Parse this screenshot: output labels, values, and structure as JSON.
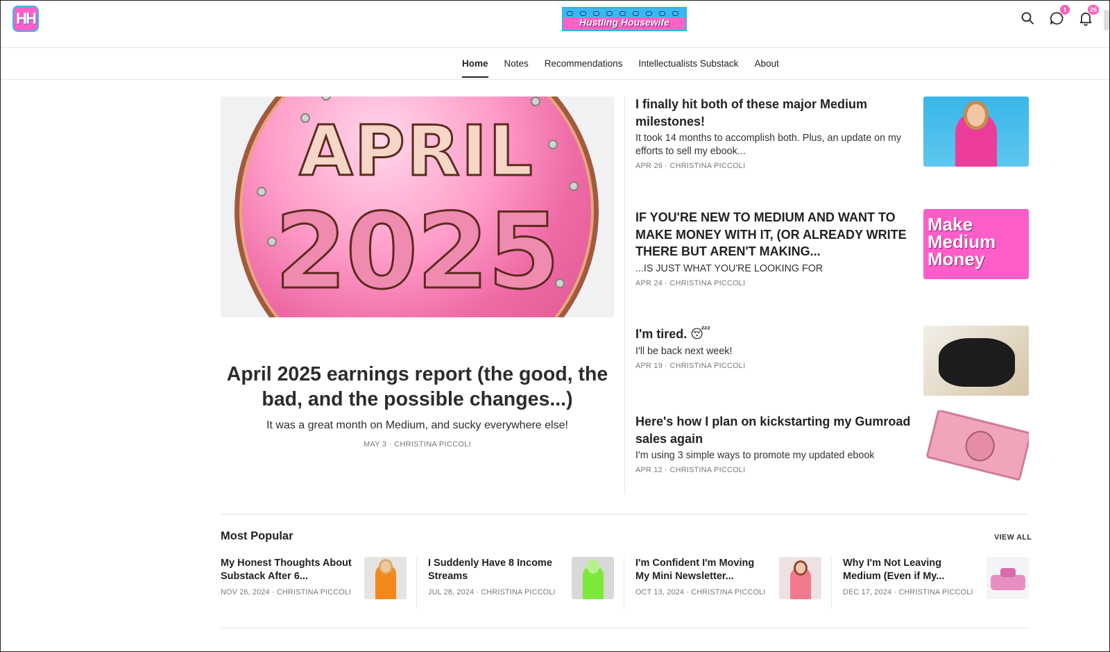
{
  "header": {
    "logo_text": "HH",
    "banner_text": "Hustling Housewife",
    "chat_badge": "1",
    "notification_badge": "26"
  },
  "nav": {
    "items": [
      "Home",
      "Notes",
      "Recommendations",
      "Intellectualists Substack",
      "About"
    ],
    "active": "Home"
  },
  "hero": {
    "image_text_line1": "APRIL",
    "image_text_line2": "2025",
    "title": "April 2025 earnings report (the good, the bad, and the possible changes...)",
    "subtitle": "It was a great month on Medium, and sucky everywhere else!",
    "meta": "MAY 3 · CHRISTINA PICCOLI"
  },
  "posts": [
    {
      "title": "I finally hit both of these major Medium milestones!",
      "subtitle": "It took 14 months to accomplish both. Plus, an update on my efforts to sell my ebook...",
      "meta": "APR 26 · CHRISTINA PICCOLI"
    },
    {
      "title": "IF YOU'RE NEW TO MEDIUM AND WANT TO MAKE MONEY WITH IT, (OR ALREADY WRITE THERE BUT AREN'T MAKING...",
      "subtitle": "...IS JUST WHAT YOU'RE LOOKING FOR",
      "meta": "APR 24 · CHRISTINA PICCOLI",
      "thumb_text": "Make Medium Money"
    },
    {
      "title": "I'm tired. 😴",
      "subtitle": "I'll be back next week!",
      "meta": "APR 19 · CHRISTINA PICCOLI"
    },
    {
      "title": "Here's how I plan on kickstarting my Gumroad sales again",
      "subtitle": "I'm using 3 simple ways to promote my updated ebook",
      "meta": "APR 12 · CHRISTINA PICCOLI"
    }
  ],
  "most_popular": {
    "heading": "Most Popular",
    "view_all": "VIEW ALL",
    "items": [
      {
        "title": "My Honest Thoughts About Substack After 6...",
        "meta": "NOV 26, 2024 · CHRISTINA PICCOLI"
      },
      {
        "title": "I Suddenly Have 8 Income Streams",
        "meta": "JUL 28, 2024 · CHRISTINA PICCOLI"
      },
      {
        "title": "I'm Confident I'm Moving My Mini Newsletter...",
        "meta": "OCT 13, 2024 · CHRISTINA PICCOLI"
      },
      {
        "title": "Why I'm Not Leaving Medium (Even if My...",
        "meta": "DEC 17, 2024 · CHRISTINA PICCOLI"
      }
    ]
  },
  "colors": {
    "brand_pink": "#ff5fc8",
    "brand_blue": "#27c1ee"
  },
  "icons": {
    "search": "search-icon",
    "chat": "chat-icon",
    "bell": "bell-icon"
  }
}
